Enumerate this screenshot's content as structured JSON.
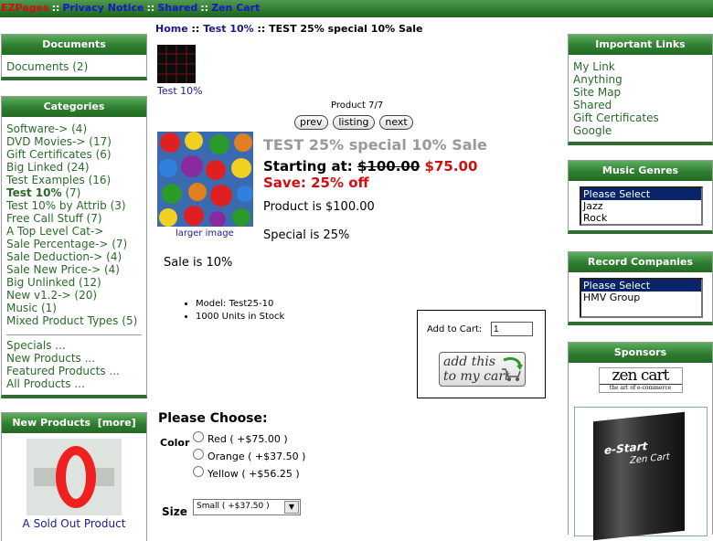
{
  "topnav": {
    "items": [
      {
        "label": "EZPages",
        "color": "#d01010"
      },
      {
        "label": "Privacy Notice"
      },
      {
        "label": "Shared"
      },
      {
        "label": "Zen Cart"
      }
    ],
    "separator": "::"
  },
  "breadcrumb": {
    "home": "Home",
    "sep": "::",
    "category": "Test 10%",
    "current": "TEST 25% special 10% Sale"
  },
  "left": {
    "documents": {
      "title": "Documents",
      "items": [
        {
          "label": "Documents",
          "count": "(2)"
        }
      ]
    },
    "categories": {
      "title": "Categories",
      "items": [
        {
          "label": "Software->",
          "count": "(4)"
        },
        {
          "label": "DVD Movies->",
          "count": "(17)"
        },
        {
          "label": "Gift Certificates",
          "count": "(6)"
        },
        {
          "label": "Big Linked",
          "count": "(24)"
        },
        {
          "label": "Test Examples",
          "count": "(16)"
        },
        {
          "label": "Test 10%",
          "count": "(7)",
          "bold": true
        },
        {
          "label": "Test 10% by Attrib",
          "count": "(3)"
        },
        {
          "label": "Free Call Stuff",
          "count": "(7)"
        },
        {
          "label": "A Top Level Cat->",
          "count": ""
        },
        {
          "label": "Sale Percentage->",
          "count": "(7)"
        },
        {
          "label": "Sale Deduction->",
          "count": "(4)"
        },
        {
          "label": "Sale New Price->",
          "count": "(4)"
        },
        {
          "label": "Big Unlinked",
          "count": "(12)"
        },
        {
          "label": "New v1.2->",
          "count": "(20)"
        },
        {
          "label": "Music",
          "count": "(1)"
        },
        {
          "label": "Mixed Product Types",
          "count": "(5)"
        }
      ],
      "links": [
        "Specials ...",
        "New Products ...",
        "Featured Products ...",
        "All Products ..."
      ]
    },
    "new_products": {
      "title": "New Products",
      "more": "[more]",
      "product_name": "A Sold Out Product"
    }
  },
  "center": {
    "thumb_label": "Test 10%",
    "product_counter": "Product 7/7",
    "nav_buttons": [
      "prev",
      "listing",
      "next"
    ],
    "larger_image": "larger image",
    "product_title": "TEST 25% special 10% Sale",
    "starting_at": "Starting at:",
    "old_price": "$100.00",
    "new_price": "$75.00",
    "save": "Save: 25% off",
    "desc1": "Product is $100.00",
    "desc2": "Special is 25%",
    "desc3": "Sale is 10%",
    "details": [
      "Model: Test25-10",
      "1000 Units in Stock"
    ],
    "cart": {
      "label": "Add to Cart:",
      "qty": "1",
      "button_line1": "add this",
      "button_line2": "to my cart"
    },
    "please_choose": "Please Choose:",
    "color_label": "Color",
    "color_options": [
      "Red ( +$75.00 )",
      "Orange ( +$37.50 )",
      "Yellow ( +$56.25 )"
    ],
    "size_label": "Size",
    "size_value": "Small ( +$37.50 )"
  },
  "right": {
    "important_links": {
      "title": "Important Links",
      "items": [
        "My Link",
        "Anything",
        "Site Map",
        "Shared",
        "Gift Certificates",
        "Google"
      ]
    },
    "music_genres": {
      "title": "Music Genres",
      "options": [
        "Please Select",
        "Jazz",
        "Rock"
      ]
    },
    "record_companies": {
      "title": "Record Companies",
      "options": [
        "Please Select",
        "HMV Group"
      ]
    },
    "sponsors": {
      "title": "Sponsors",
      "logo_main": "zen cart",
      "logo_tag": "the art of e-commerce",
      "book_title": "e-Start",
      "book_brand": "Zen Cart"
    }
  },
  "colors": {
    "header_green": "#2f7e2f",
    "link_green": "#2a6a2a",
    "price_red": "#d01010",
    "link_blue": "#1818c8"
  }
}
